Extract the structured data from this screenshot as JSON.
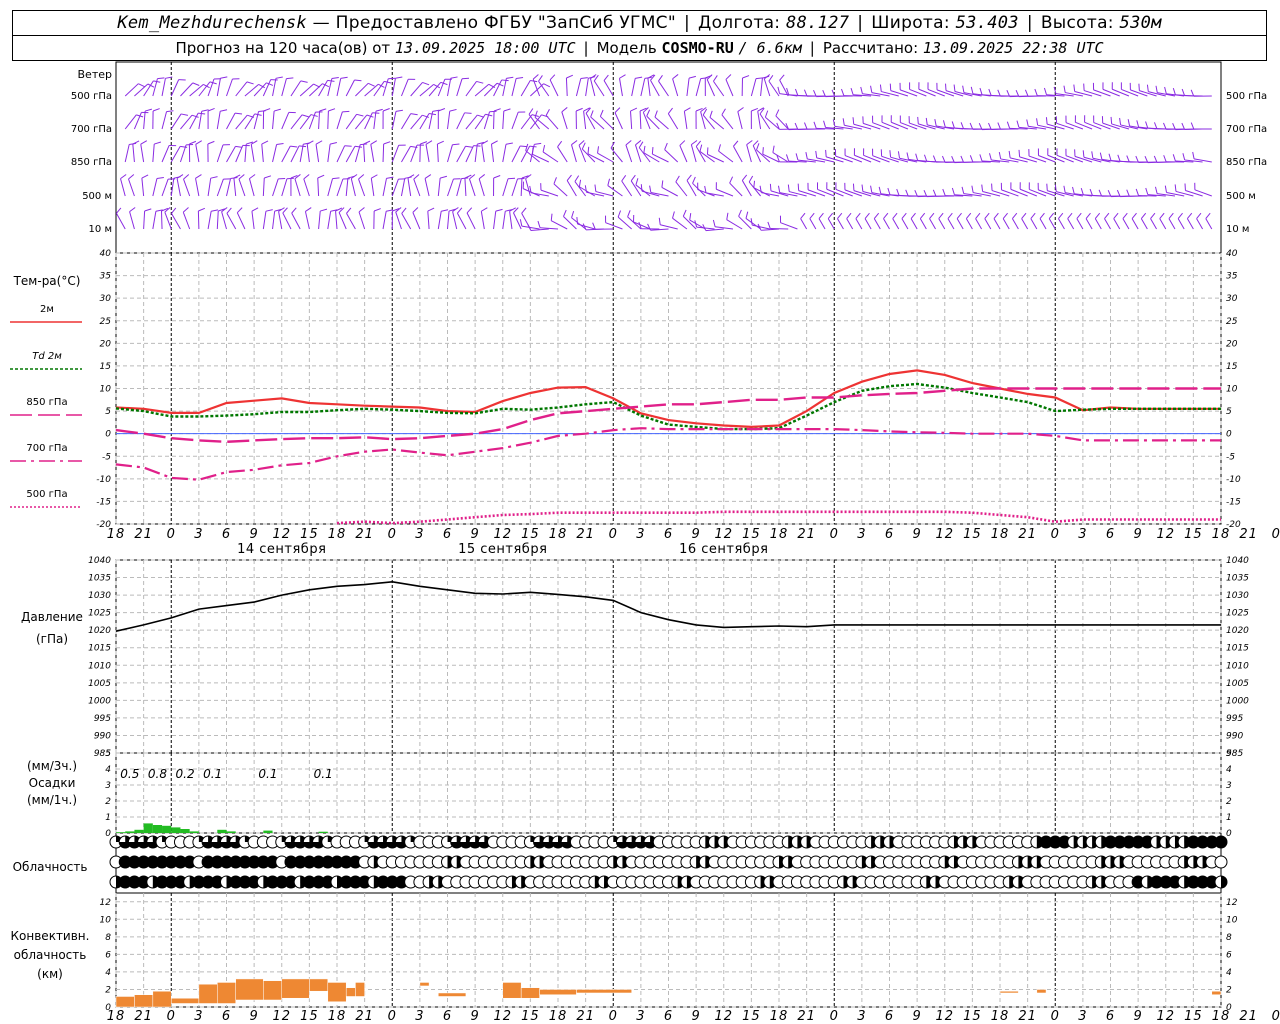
{
  "header": {
    "station": "Kem_Mezhdurechensk",
    "provided_by": "— Предоставлено ФГБУ \"ЗапСиб УГМС\"",
    "lon_label": "Долгота:",
    "lon_value": "88.127",
    "lat_label": "Широта:",
    "lat_value": "53.403",
    "alt_label": "Высота:",
    "alt_value": "530м",
    "forecast_label": "Прогноз на 120 часа(ов)  от",
    "forecast_start": "13.09.2025 18:00 UTC",
    "model_label": "Модель",
    "model_name": "COSMO-RU",
    "model_res": "/ 6.6км",
    "calc_label": "Рассчитано:",
    "calc_time": "13.09.2025 22:38 UTC",
    "sep": "|"
  },
  "labels": {
    "wind": "Ветер",
    "wind_levels": [
      "500 гПа",
      "700 гПа",
      "850 гПа",
      "500 м",
      "10  м"
    ],
    "temp": "Тем-ра(°С)",
    "temp_legend": [
      "2м",
      "Td  2м",
      "850 гПа",
      "700 гПа",
      "500 гПа"
    ],
    "pressure": [
      "Давление",
      "(гПа)"
    ],
    "precip": [
      "(мм/3ч.)",
      "Осадки",
      "(мм/1ч.)"
    ],
    "cloud": "Облачность",
    "conv": [
      "Конвективн.",
      "облачность",
      "(км)"
    ]
  },
  "colors": {
    "wind": "#8a2be2",
    "t2m": "#ee3333",
    "td2m": "#007700",
    "t850": "#e0208a",
    "t700": "#e0208a",
    "t500": "#e0208a",
    "pressure": "#000000",
    "precip": "#22bb22",
    "conv": "#ee8833"
  },
  "chart_data": [
    {
      "type": "line",
      "panel": "temperature",
      "ylim": [
        -20,
        40
      ],
      "yticks": [
        -20,
        -15,
        -10,
        -5,
        0,
        5,
        10,
        15,
        20,
        25,
        30,
        35,
        40
      ],
      "x_hours_from_start": [
        0,
        3,
        6,
        9,
        12,
        15,
        18,
        21,
        24,
        27,
        30,
        33,
        36,
        39,
        42,
        45,
        48,
        51,
        54,
        57,
        60,
        63,
        66,
        69,
        72,
        75,
        78,
        81,
        84,
        87,
        90,
        93,
        96,
        99,
        102,
        105,
        108,
        111,
        114,
        117,
        120
      ],
      "x_tick_labels": [
        "18",
        "21",
        "0",
        "3",
        "6",
        "9",
        "12",
        "15",
        "18",
        "21",
        "0",
        "3",
        "6",
        "9",
        "12",
        "15",
        "18",
        "21",
        "0",
        "3",
        "6",
        "9",
        "12",
        "15",
        "18",
        "21",
        "0",
        "3",
        "6",
        "9",
        "12",
        "15",
        "18",
        "21",
        "0",
        "3",
        "6",
        "9",
        "12",
        "15",
        "18",
        "21",
        "0"
      ],
      "day_labels": [
        "14 сентября",
        "15 сентября",
        "16 сентября"
      ],
      "series": [
        {
          "name": "2м",
          "values": [
            5.8,
            5.5,
            4.6,
            4.6,
            6.8,
            7.3,
            7.8,
            6.8,
            6.5,
            6.2,
            6.0,
            5.8,
            5.0,
            4.8,
            7.2,
            9.0,
            10.2,
            10.3,
            7.8,
            4.5,
            3.0,
            2.3,
            1.8,
            1.5,
            1.8,
            5.0,
            9.0,
            11.5,
            13.2,
            14.0,
            13.0,
            11.2,
            10.0,
            8.8,
            8.0,
            5.2,
            5.8,
            5.5,
            5.5,
            5.5,
            5.5
          ]
        },
        {
          "name": "Td  2м",
          "values": [
            5.6,
            5.0,
            3.8,
            3.8,
            4.0,
            4.3,
            4.8,
            4.8,
            5.2,
            5.5,
            5.3,
            5.0,
            4.6,
            4.5,
            5.5,
            5.3,
            5.8,
            6.5,
            7.0,
            4.0,
            2.0,
            1.5,
            1.0,
            1.0,
            1.2,
            4.0,
            7.0,
            9.5,
            10.5,
            11.0,
            10.2,
            9.0,
            8.0,
            7.0,
            5.0,
            5.3,
            5.5,
            5.5,
            5.5,
            5.5,
            5.5
          ]
        },
        {
          "name": "850 гПа",
          "values": [
            0.8,
            0.0,
            -1.0,
            -1.5,
            -1.8,
            -1.5,
            -1.2,
            -1.0,
            -1.0,
            -0.8,
            -1.2,
            -1.0,
            -0.5,
            0.0,
            1.0,
            3.0,
            4.5,
            5.0,
            5.5,
            6.0,
            6.5,
            6.5,
            7.0,
            7.5,
            7.5,
            8.0,
            8.0,
            8.5,
            8.8,
            9.0,
            9.5,
            10.0,
            10.0,
            10.0,
            10.0,
            10.0,
            10.0,
            10.0,
            10.0,
            10.0,
            10.0
          ]
        },
        {
          "name": "700 гПа",
          "values": [
            -6.8,
            -7.5,
            -9.8,
            -10.2,
            -8.5,
            -8.0,
            -7.0,
            -6.5,
            -5.0,
            -4.0,
            -3.5,
            -4.2,
            -4.8,
            -4.0,
            -3.2,
            -2.0,
            -0.5,
            0.0,
            0.8,
            1.2,
            1.0,
            1.0,
            1.0,
            1.0,
            1.0,
            1.0,
            1.0,
            0.8,
            0.5,
            0.3,
            0.2,
            0.0,
            0.0,
            0.0,
            -0.5,
            -1.5,
            -1.5,
            -1.5,
            -1.5,
            -1.5,
            -1.5
          ]
        },
        {
          "name": "500 гПа",
          "values": [
            null,
            null,
            null,
            null,
            null,
            null,
            null,
            null,
            -19.8,
            -19.5,
            -19.8,
            -19.5,
            -19.0,
            -18.5,
            -18.0,
            -17.8,
            -17.5,
            -17.5,
            -17.5,
            -17.5,
            -17.5,
            -17.5,
            -17.3,
            -17.3,
            -17.3,
            -17.3,
            -17.3,
            -17.3,
            -17.3,
            -17.3,
            -17.3,
            -17.5,
            -18.0,
            -18.5,
            -19.5,
            -19.0,
            -19.0,
            -19.0,
            -19.0,
            -19.0,
            -19.0
          ]
        }
      ]
    },
    {
      "type": "line",
      "panel": "pressure",
      "ylim": [
        985,
        1040
      ],
      "yticks": [
        985,
        990,
        995,
        1000,
        1005,
        1010,
        1015,
        1020,
        1025,
        1030,
        1035,
        1040
      ],
      "series": [
        {
          "name": "Давление",
          "values": [
            1019.7,
            1021.5,
            1023.5,
            1026.0,
            1027.0,
            1028.0,
            1030.0,
            1031.5,
            1032.5,
            1033.0,
            1033.8,
            1032.5,
            1031.5,
            1030.5,
            1030.3,
            1030.8,
            1030.2,
            1029.5,
            1028.5,
            1025.0,
            1023.0,
            1021.5,
            1020.8,
            1021.0,
            1021.2,
            1021.0,
            1021.5,
            1021.5,
            1021.5,
            1021.5,
            1021.5,
            1021.5,
            1021.5,
            1021.5,
            1021.5,
            1021.5,
            1021.5,
            1021.5,
            1021.5,
            1021.5,
            1021.5
          ]
        }
      ]
    },
    {
      "type": "bar",
      "panel": "precipitation",
      "ylim": [
        0,
        5
      ],
      "yticks": [
        0,
        1,
        2,
        3,
        4,
        5
      ],
      "precip_3h_labels": [
        {
          "hour": 1.5,
          "text": "0.5"
        },
        {
          "hour": 4.5,
          "text": "0.8"
        },
        {
          "hour": 7.5,
          "text": "0.2"
        },
        {
          "hour": 10.5,
          "text": "0.1"
        },
        {
          "hour": 16.5,
          "text": "0.1"
        },
        {
          "hour": 22.5,
          "text": "0.1"
        }
      ],
      "hourly": [
        {
          "hour": 0,
          "value": 0.05
        },
        {
          "hour": 1,
          "value": 0.1
        },
        {
          "hour": 2,
          "value": 0.2
        },
        {
          "hour": 3,
          "value": 0.6
        },
        {
          "hour": 4,
          "value": 0.5
        },
        {
          "hour": 5,
          "value": 0.45
        },
        {
          "hour": 6,
          "value": 0.35
        },
        {
          "hour": 7,
          "value": 0.25
        },
        {
          "hour": 8,
          "value": 0.1
        },
        {
          "hour": 11,
          "value": 0.2
        },
        {
          "hour": 12,
          "value": 0.1
        },
        {
          "hour": 16,
          "value": 0.15
        },
        {
          "hour": 22,
          "value": 0.08
        }
      ]
    },
    {
      "type": "bar",
      "panel": "convective_cloud",
      "ylim": [
        0,
        13
      ],
      "yticks": [
        0,
        2,
        4,
        6,
        8,
        10,
        12
      ],
      "segments": [
        {
          "start": 0,
          "end": 2,
          "base": 0,
          "top": 1.2
        },
        {
          "start": 2,
          "end": 4,
          "base": 0,
          "top": 1.4
        },
        {
          "start": 4,
          "end": 6,
          "base": 0,
          "top": 1.8
        },
        {
          "start": 6,
          "end": 9,
          "base": 0.4,
          "top": 1.0
        },
        {
          "start": 9,
          "end": 11,
          "base": 0.4,
          "top": 2.6
        },
        {
          "start": 11,
          "end": 13,
          "base": 0.4,
          "top": 2.8
        },
        {
          "start": 13,
          "end": 16,
          "base": 0.8,
          "top": 3.2
        },
        {
          "start": 16,
          "end": 18,
          "base": 0.8,
          "top": 3.0
        },
        {
          "start": 18,
          "end": 21,
          "base": 1.0,
          "top": 3.2
        },
        {
          "start": 21,
          "end": 23,
          "base": 1.8,
          "top": 3.2
        },
        {
          "start": 23,
          "end": 25,
          "base": 0.6,
          "top": 2.8
        },
        {
          "start": 25,
          "end": 26,
          "base": 1.2,
          "top": 2.2
        },
        {
          "start": 26,
          "end": 27,
          "base": 1.2,
          "top": 2.8
        },
        {
          "start": 33,
          "end": 34,
          "base": 2.4,
          "top": 2.8
        },
        {
          "start": 35,
          "end": 38,
          "base": 1.2,
          "top": 1.6
        },
        {
          "start": 42,
          "end": 44,
          "base": 1.0,
          "top": 2.8
        },
        {
          "start": 44,
          "end": 46,
          "base": 1.0,
          "top": 2.2
        },
        {
          "start": 46,
          "end": 50,
          "base": 1.4,
          "top": 2.0
        },
        {
          "start": 50,
          "end": 56,
          "base": 1.6,
          "top": 2.0
        },
        {
          "start": 96,
          "end": 98,
          "base": 1.6,
          "top": 1.8
        },
        {
          "start": 100,
          "end": 101,
          "base": 1.6,
          "top": 2.0
        },
        {
          "start": 119,
          "end": 120,
          "base": 1.4,
          "top": 1.8
        }
      ]
    }
  ]
}
